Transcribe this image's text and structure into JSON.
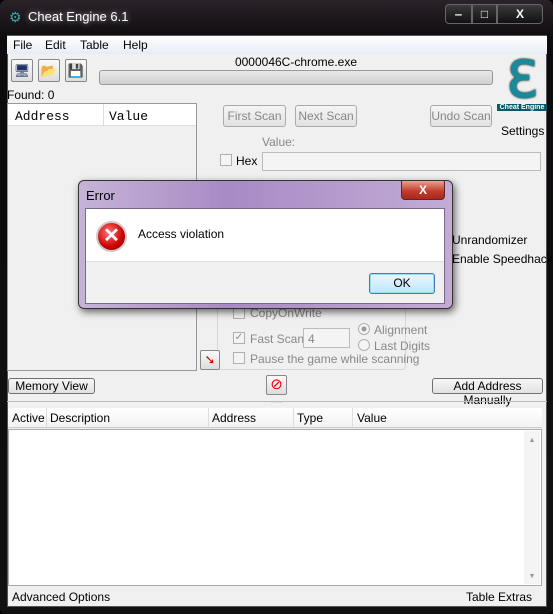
{
  "window": {
    "title": "Cheat Engine 6.1",
    "minimize": "‒",
    "maximize": "□",
    "close": "X"
  },
  "menu": [
    "File",
    "Edit",
    "Table",
    "Help"
  ],
  "toolbar": {
    "process": "0000046C-chrome.exe",
    "progress": 0,
    "icons": [
      "open-process-icon",
      "open-file-icon",
      "save-icon"
    ]
  },
  "found": "Found: 0",
  "results": {
    "columns": [
      "Address",
      "Value"
    ]
  },
  "scan": {
    "first": "First Scan",
    "next": "Next Scan",
    "undo": "Undo Scan",
    "value_label": "Value:",
    "hex": "Hex",
    "settings": "Settings",
    "logo_text": "Cheat Engine",
    "unrandomizer": "Unrandomizer",
    "speedhack": "Enable Speedhack",
    "copyonwrite": "CopyOnWrite",
    "fastscan": "Fast Scan",
    "fastscan_value": "4",
    "alignment": "Alignment",
    "lastdigits": "Last Digits",
    "pause": "Pause the game while scanning"
  },
  "buttons": {
    "memory_view": "Memory View",
    "add_address": "Add Address Manually"
  },
  "table": {
    "columns": [
      "Active",
      "Description",
      "Address",
      "Type",
      "Value"
    ]
  },
  "status": {
    "left": "Advanced Options",
    "right": "Table Extras"
  },
  "dialog": {
    "title": "Error",
    "message": "Access violation",
    "ok": "OK",
    "close": "X"
  }
}
